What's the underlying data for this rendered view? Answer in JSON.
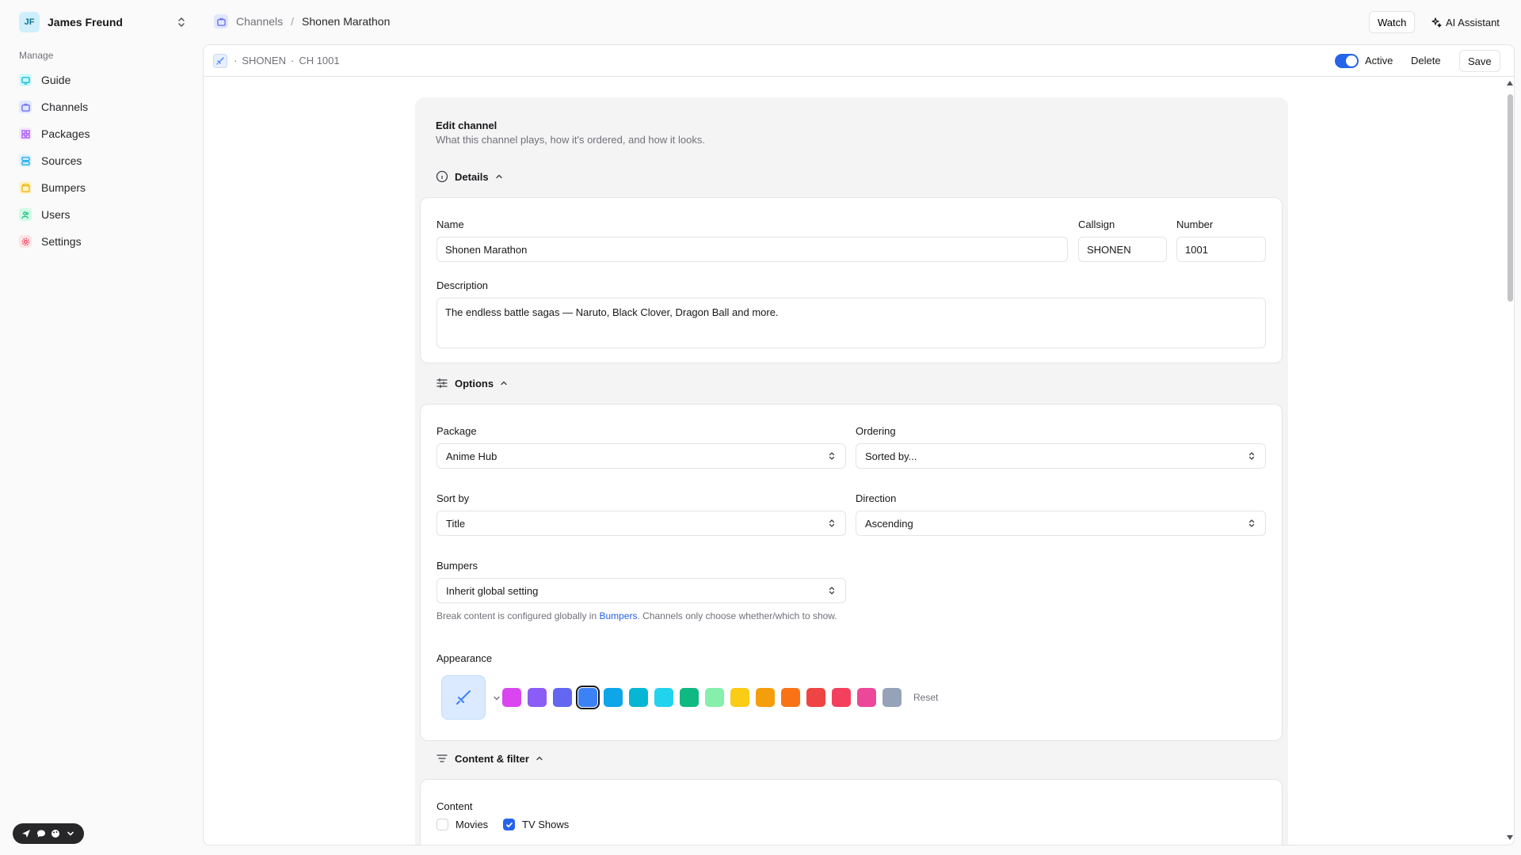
{
  "user": {
    "initials": "JF",
    "name": "James Freund"
  },
  "sidebar": {
    "section": "Manage",
    "items": [
      {
        "label": "Guide",
        "color": "#06b6d4",
        "bg": "#cffafe"
      },
      {
        "label": "Channels",
        "color": "#6366f1",
        "bg": "#e0e7ff"
      },
      {
        "label": "Packages",
        "color": "#a855f7",
        "bg": "#f3e8ff"
      },
      {
        "label": "Sources",
        "color": "#0ea5e9",
        "bg": "#e0f2fe"
      },
      {
        "label": "Bumpers",
        "color": "#eab308",
        "bg": "#fef3c7"
      },
      {
        "label": "Users",
        "color": "#10b981",
        "bg": "#d1fae5"
      },
      {
        "label": "Settings",
        "color": "#f43f5e",
        "bg": "#ffe4e6"
      }
    ]
  },
  "header": {
    "breadcrumb": {
      "parent": "Channels",
      "sep": "/",
      "current": "Shonen Marathon"
    },
    "watch": "Watch",
    "ai": "AI Assistant"
  },
  "channel_bar": {
    "sep1": "·",
    "callsign": "SHONEN",
    "sep2": "·",
    "number": "CH 1001",
    "active_label": "Active",
    "active": true,
    "delete": "Delete",
    "save": "Save"
  },
  "form": {
    "title": "Edit channel",
    "subtitle": "What this channel plays, how it's ordered, and how it looks.",
    "details": {
      "heading": "Details",
      "name_label": "Name",
      "name": "Shonen Marathon",
      "callsign_label": "Callsign",
      "callsign": "SHONEN",
      "number_label": "Number",
      "number": "1001",
      "description_label": "Description",
      "description": "The endless battle sagas — Naruto, Black Clover, Dragon Ball and more."
    },
    "options": {
      "heading": "Options",
      "package_label": "Package",
      "package": "Anime Hub",
      "ordering_label": "Ordering",
      "ordering": "Sorted by...",
      "sortby_label": "Sort by",
      "sortby": "Title",
      "direction_label": "Direction",
      "direction": "Ascending",
      "bumpers_label": "Bumpers",
      "bumpers": "Inherit global setting",
      "help_pre": "Break content is configured globally in ",
      "help_link": "Bumpers",
      "help_post": ". Channels only choose whether/which to show.",
      "appearance_label": "Appearance",
      "icon": "sword-icon",
      "swatches": [
        "#d946ef",
        "#8b5cf6",
        "#6366f1",
        "#3b82f6",
        "#0ea5e9",
        "#06b6d4",
        "#22d3ee",
        "#10b981",
        "#86efac",
        "#facc15",
        "#f59e0b",
        "#f97316",
        "#ef4444",
        "#f43f5e",
        "#ec4899",
        "#94a3b8"
      ],
      "selected_swatch": 3,
      "reset": "Reset"
    },
    "content": {
      "heading": "Content & filter",
      "label": "Content",
      "movies": "Movies",
      "movies_checked": false,
      "tv": "TV Shows",
      "tv_checked": true
    }
  }
}
